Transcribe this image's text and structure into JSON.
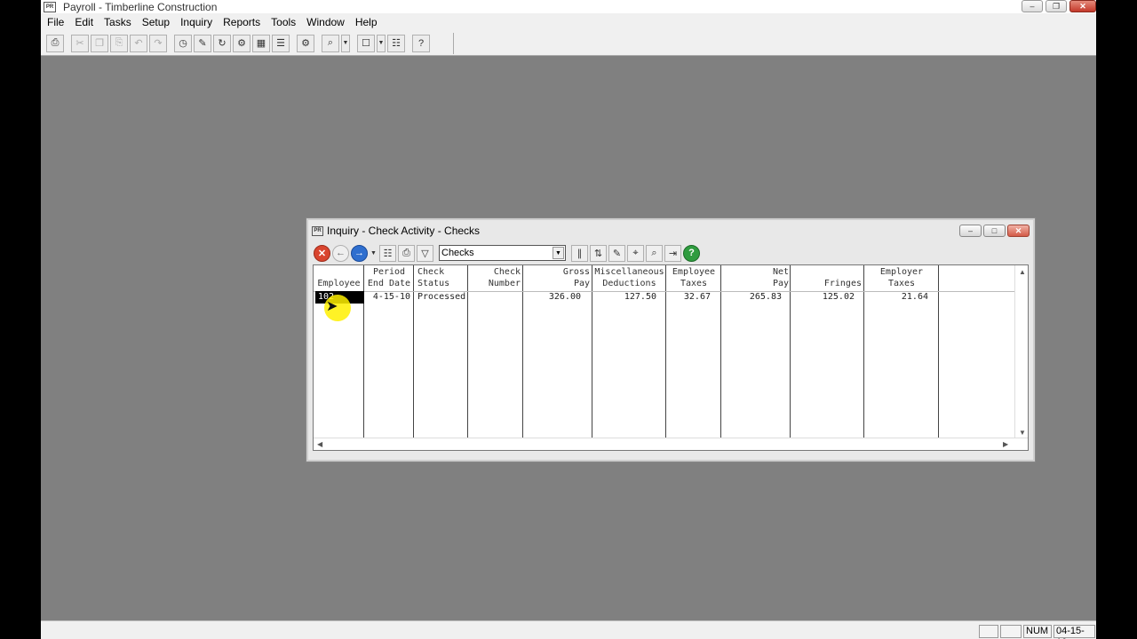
{
  "window": {
    "title": "Payroll - Timberline Construction",
    "app_icon_text": "PR"
  },
  "menu": [
    "File",
    "Edit",
    "Tasks",
    "Setup",
    "Inquiry",
    "Reports",
    "Tools",
    "Window",
    "Help"
  ],
  "child_window": {
    "title": "Inquiry - Check Activity - Checks",
    "icon_text": "PR",
    "view_select": {
      "value": "Checks"
    }
  },
  "grid": {
    "headers": [
      {
        "line1": "",
        "line2": "Employee"
      },
      {
        "line1": "Period",
        "line2": "End Date"
      },
      {
        "line1": "Check",
        "line2": "Status"
      },
      {
        "line1": "Check",
        "line2": "Number"
      },
      {
        "line1": "Gross",
        "line2": "Pay"
      },
      {
        "line1": "Miscellaneous",
        "line2": "Deductions"
      },
      {
        "line1": "Employee",
        "line2": "Taxes"
      },
      {
        "line1": "Net",
        "line2": "Pay"
      },
      {
        "line1": "",
        "line2": "Fringes"
      },
      {
        "line1": "Employer",
        "line2": "Taxes"
      }
    ],
    "rows": [
      [
        "102",
        "4-15-10",
        "Processed",
        "",
        "326.00",
        "127.50",
        "32.67",
        "265.83",
        "125.02",
        "21.64"
      ]
    ]
  },
  "statusbar": {
    "num": "NUM",
    "date": "04-15-10"
  },
  "colors": {
    "workspace": "#808080",
    "chrome": "#f0f0f0",
    "selection": "#000000",
    "highlight": "#fff000"
  }
}
